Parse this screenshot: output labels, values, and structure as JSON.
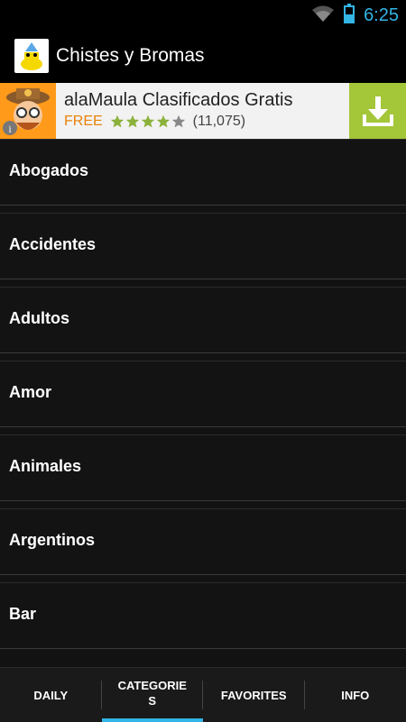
{
  "status": {
    "time": "6:25"
  },
  "app": {
    "title": "Chistes y Bromas"
  },
  "ad": {
    "title": "alaMaula Clasificados Gratis",
    "price": "FREE",
    "rating": 4,
    "rating_count": "(11,075)",
    "install_color": "#a4c639"
  },
  "categories": [
    {
      "label": "Abogados"
    },
    {
      "label": "Accidentes"
    },
    {
      "label": "Adultos"
    },
    {
      "label": "Amor"
    },
    {
      "label": "Animales"
    },
    {
      "label": "Argentinos"
    },
    {
      "label": "Bar"
    }
  ],
  "tabs": [
    {
      "label": "DAILY",
      "active": false
    },
    {
      "label": "CATEGORIES",
      "active": true
    },
    {
      "label": "FAVORITES",
      "active": false
    },
    {
      "label": "INFO",
      "active": false
    }
  ],
  "colors": {
    "accent": "#33b5e5",
    "background": "#121212"
  }
}
